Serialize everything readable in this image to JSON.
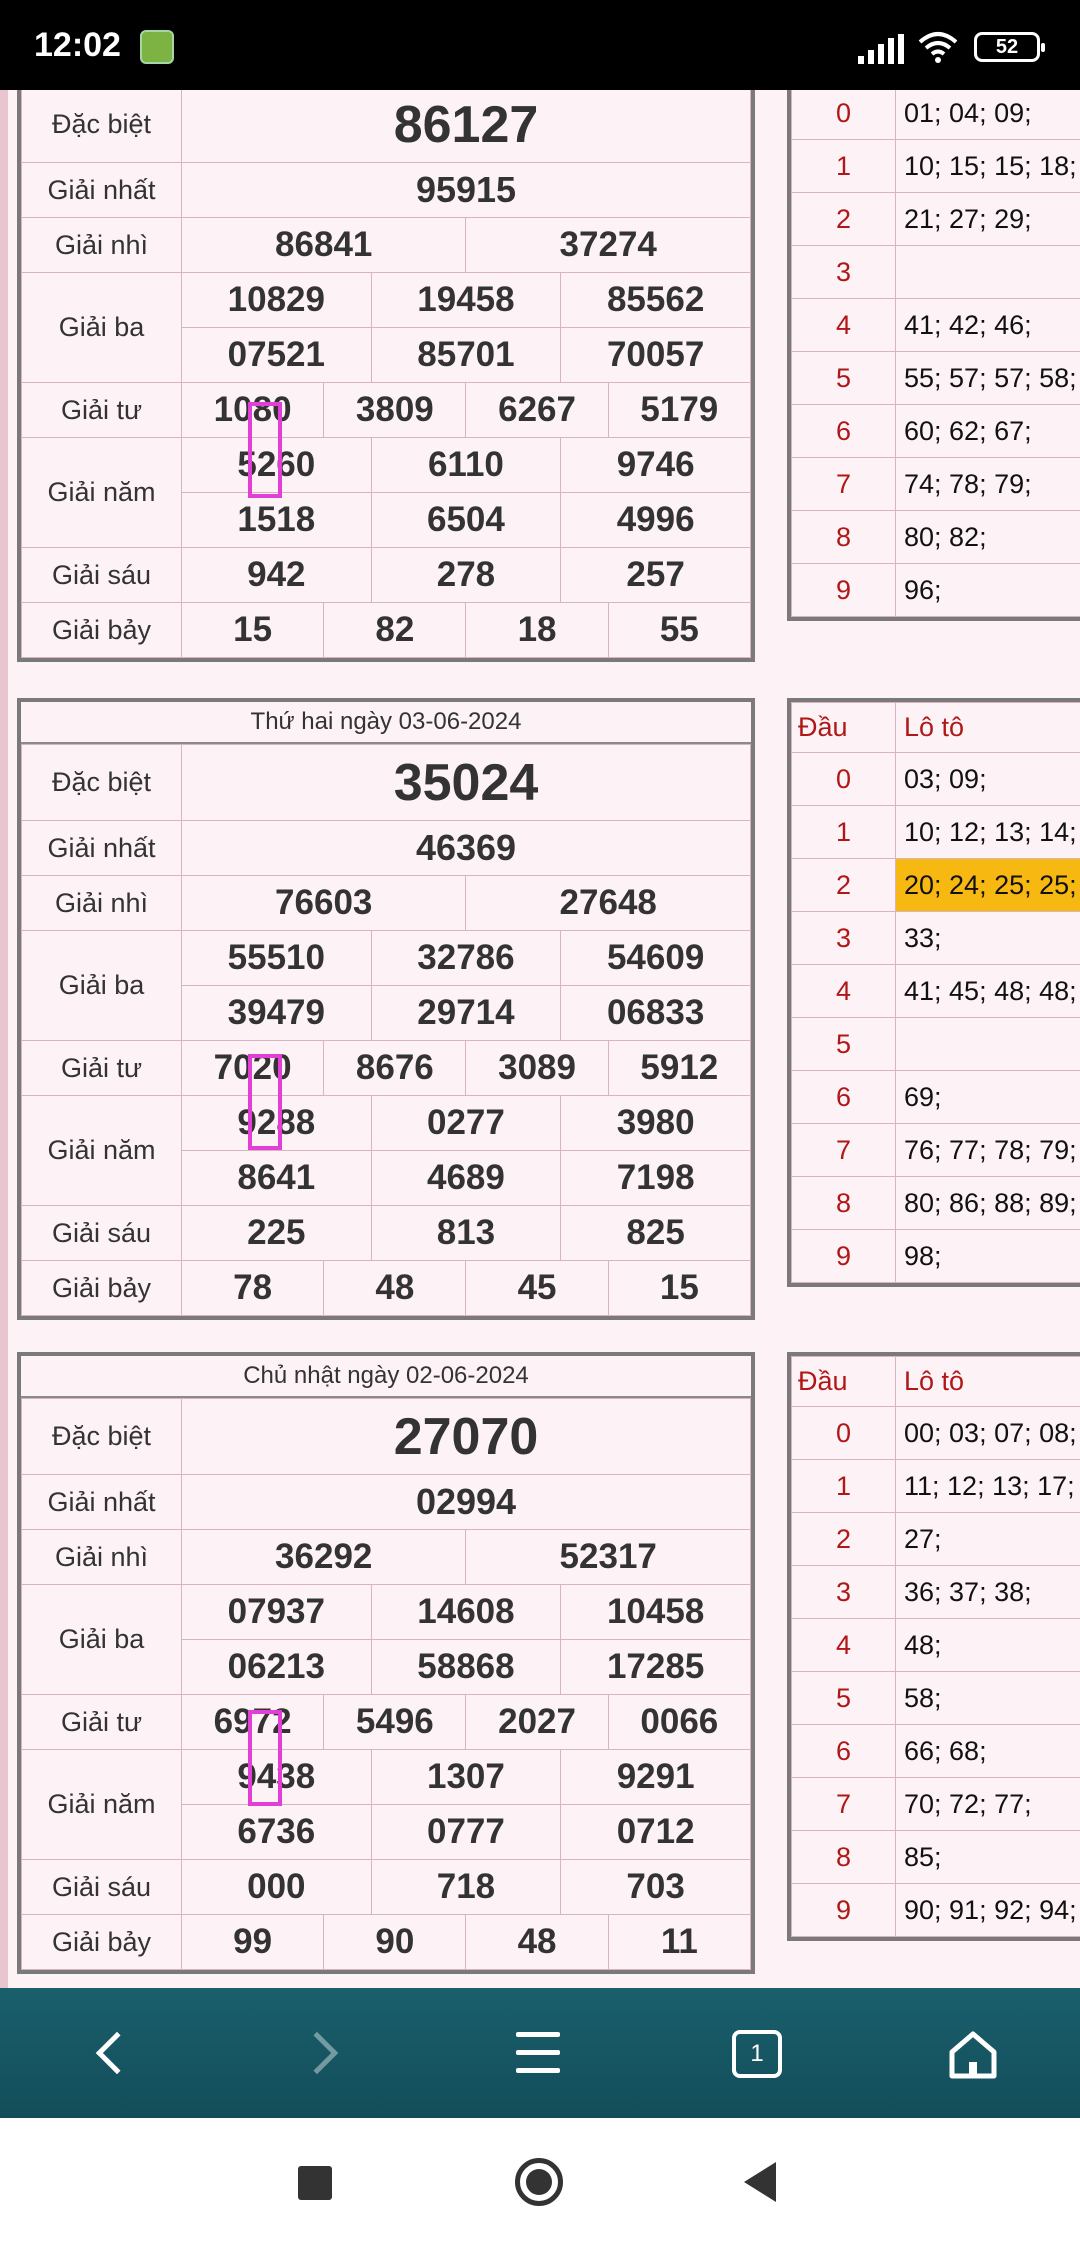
{
  "status": {
    "time": "12:02",
    "battery": "52"
  },
  "labels": {
    "db": "Đặc biệt",
    "g1": "Giải nhất",
    "g2": "Giải nhì",
    "g3": "Giải ba",
    "g4": "Giải tư",
    "g5": "Giải năm",
    "g6": "Giải sáu",
    "g7": "Giải bảy",
    "dau": "Đầu",
    "loto": "Lô tô"
  },
  "draws": [
    {
      "date": "",
      "db": "86127",
      "g1": "95915",
      "g2": [
        "86841",
        "37274"
      ],
      "g3a": [
        "10829",
        "19458",
        "85562"
      ],
      "g3b": [
        "07521",
        "85701",
        "70057"
      ],
      "g4": [
        "1080",
        "3809",
        "6267",
        "5179"
      ],
      "g5a": [
        "5260",
        "6110",
        "9746"
      ],
      "g5b": [
        "1518",
        "6504",
        "4996"
      ],
      "g6": [
        "942",
        "278",
        "257"
      ],
      "g7": [
        "15",
        "82",
        "18",
        "55"
      ],
      "loto": [
        "01; 04; 09;",
        "10; 15; 15; 18;",
        "21; 27; 29;",
        "",
        "41; 42; 46;",
        "55; 57; 57; 58;",
        "60; 62; 67;",
        "74; 78; 79;",
        "80; 82;",
        "96;"
      ]
    },
    {
      "date": "Thứ hai ngày 03-06-2024",
      "db": "35024",
      "g1": "46369",
      "g2": [
        "76603",
        "27648"
      ],
      "g3a": [
        "55510",
        "32786",
        "54609"
      ],
      "g3b": [
        "39479",
        "29714",
        "06833"
      ],
      "g4": [
        "7020",
        "8676",
        "3089",
        "5912"
      ],
      "g5a": [
        "9288",
        "0277",
        "3980"
      ],
      "g5b": [
        "8641",
        "4689",
        "7198"
      ],
      "g6": [
        "225",
        "813",
        "825"
      ],
      "g7": [
        "78",
        "48",
        "45",
        "15"
      ],
      "loto": [
        "03; 09;",
        "10; 12; 13; 14;",
        "20; 24; 25; 25;",
        "33;",
        "41; 45; 48; 48;",
        "",
        "69;",
        "76; 77; 78; 79;",
        "80; 86; 88; 89;",
        "98;"
      ]
    },
    {
      "date": "Chủ nhật ngày 02-06-2024",
      "db": "27070",
      "g1": "02994",
      "g2": [
        "36292",
        "52317"
      ],
      "g3a": [
        "07937",
        "14608",
        "10458"
      ],
      "g3b": [
        "06213",
        "58868",
        "17285"
      ],
      "g4": [
        "6972",
        "5496",
        "2027",
        "0066"
      ],
      "g5a": [
        "9438",
        "1307",
        "9291"
      ],
      "g5b": [
        "6736",
        "0777",
        "0712"
      ],
      "g6": [
        "000",
        "718",
        "703"
      ],
      "g7": [
        "99",
        "90",
        "48",
        "11"
      ],
      "loto": [
        "00; 03; 07; 08;",
        "11; 12; 13; 17;",
        "27;",
        "36; 37; 38;",
        "48;",
        "58;",
        "66; 68;",
        "70; 72; 77;",
        "85;",
        "90; 91; 92; 94;"
      ]
    }
  ],
  "browser": {
    "tab_count": "1"
  }
}
